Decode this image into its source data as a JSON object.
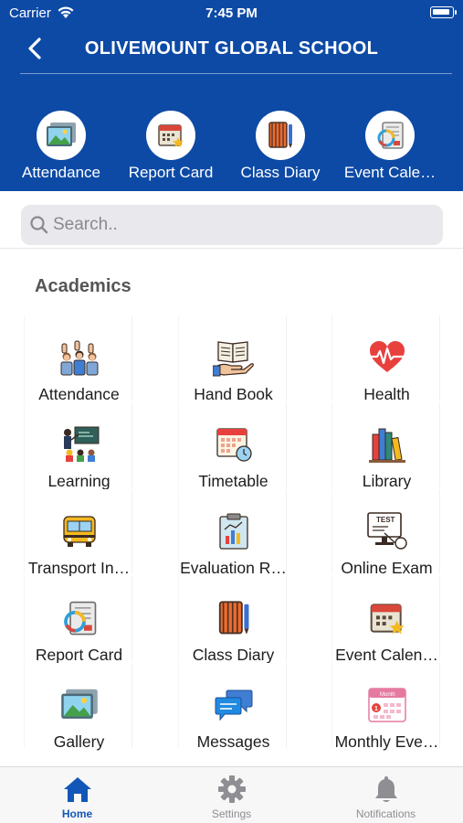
{
  "status_bar": {
    "carrier": "Carrier",
    "time": "7:45 PM"
  },
  "nav": {
    "title": "OLIVEMOUNT GLOBAL SCHOOL"
  },
  "quick_links": [
    {
      "label": "Attendance",
      "icon": "gallery-icon"
    },
    {
      "label": "Report Card",
      "icon": "calendar-star-icon"
    },
    {
      "label": "Class Diary",
      "icon": "notebook-icon"
    },
    {
      "label": "Event Cale…",
      "icon": "report-icon"
    }
  ],
  "search": {
    "placeholder": "Search.."
  },
  "section": {
    "title": "Academics"
  },
  "tiles": [
    {
      "label": "Attendance",
      "icon": "raised-hands-icon"
    },
    {
      "label": "Hand Book",
      "icon": "handbook-icon"
    },
    {
      "label": "Health",
      "icon": "heartbeat-icon"
    },
    {
      "label": "Learning",
      "icon": "classroom-icon"
    },
    {
      "label": "Timetable",
      "icon": "timetable-icon"
    },
    {
      "label": "Library",
      "icon": "books-icon"
    },
    {
      "label": "Transport In…",
      "icon": "school-bus-icon"
    },
    {
      "label": "Evaluation R…",
      "icon": "clipboard-chart-icon"
    },
    {
      "label": "Online Exam",
      "icon": "test-monitor-icon"
    },
    {
      "label": "Report Card",
      "icon": "report-icon"
    },
    {
      "label": "Class Diary",
      "icon": "notebook-icon"
    },
    {
      "label": "Event Calen…",
      "icon": "calendar-star-icon"
    },
    {
      "label": "Gallery",
      "icon": "gallery-icon"
    },
    {
      "label": "Messages",
      "icon": "chat-bubbles-icon"
    },
    {
      "label": "Monthly Eve…",
      "icon": "month-calendar-icon"
    }
  ],
  "tab_bar": [
    {
      "label": "Home",
      "icon": "home-icon",
      "active": true
    },
    {
      "label": "Settings",
      "icon": "gear-icon",
      "active": false
    },
    {
      "label": "Notifications",
      "icon": "bell-icon",
      "active": false
    }
  ],
  "colors": {
    "brand": "#0d4aa5",
    "tab_active": "#1257b8",
    "tab_inactive": "#8e8e93"
  }
}
